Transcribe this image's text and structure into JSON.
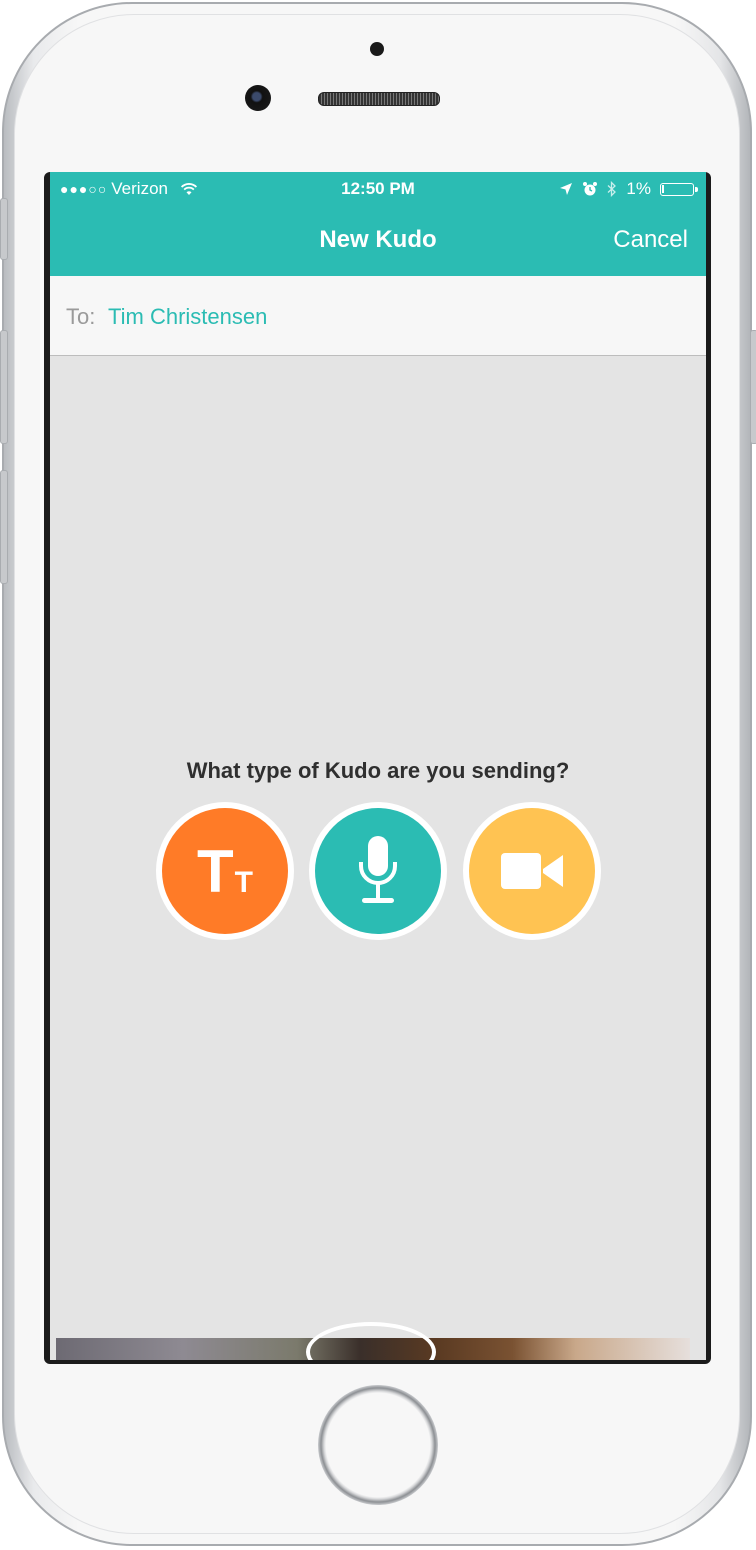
{
  "status_bar": {
    "signal_dots": "●●●○○",
    "carrier": "Verizon",
    "time": "12:50 PM",
    "battery_text": "1%",
    "battery_level": 0.01
  },
  "nav": {
    "title": "New Kudo",
    "cancel_label": "Cancel"
  },
  "recipient": {
    "label": "To:",
    "name": "Tim Christensen"
  },
  "prompt": "What type of Kudo are you sending?",
  "kudo_types": [
    {
      "label_big": "T",
      "label_small": "T",
      "icon": "text-icon",
      "color": "#ff7b27"
    },
    {
      "icon": "microphone-icon",
      "color": "#2bbcb3"
    },
    {
      "icon": "video-camera-icon",
      "color": "#ffc352"
    }
  ],
  "colors": {
    "accent": "#2bbcb3",
    "text_kudo": "#ff7b27",
    "audio_kudo": "#2bbcb3",
    "video_kudo": "#ffc352",
    "background": "#e4e4e4"
  }
}
